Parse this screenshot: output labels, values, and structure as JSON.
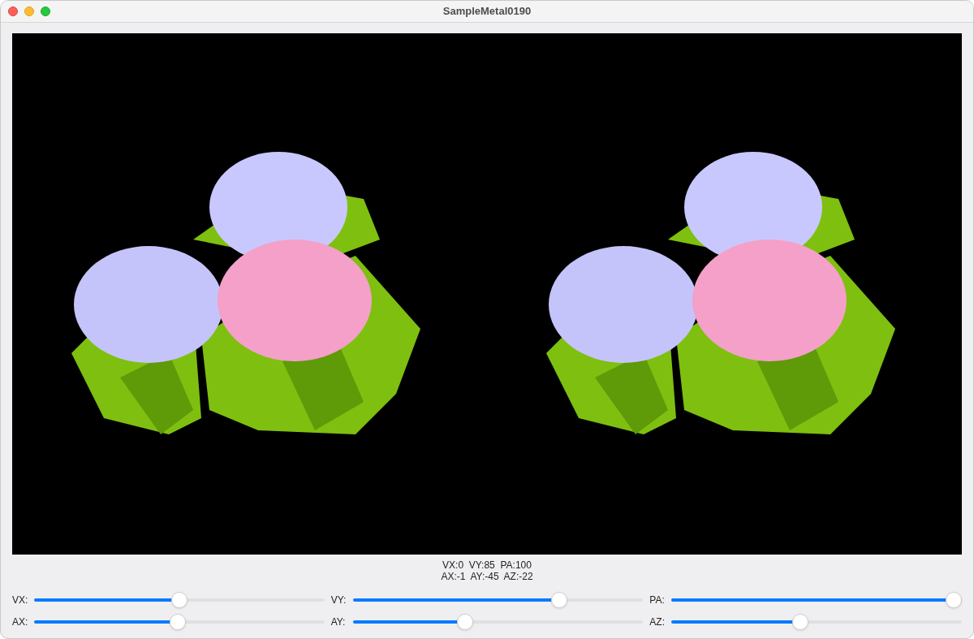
{
  "window": {
    "title": "SampleMetal0190"
  },
  "readout": [
    "VX:0  VY:85  PA:100",
    "AX:-1  AY:-45  AZ:-22"
  ],
  "sliders": [
    {
      "label": "VX:",
      "level": 0.5
    },
    {
      "label": "VY:",
      "level": 0.725
    },
    {
      "label": "PA:",
      "level": 1.0
    },
    {
      "label": "AX:",
      "level": 0.495
    },
    {
      "label": "AY:",
      "level": 0.38
    },
    {
      "label": "AZ:",
      "level": 0.44
    }
  ]
}
